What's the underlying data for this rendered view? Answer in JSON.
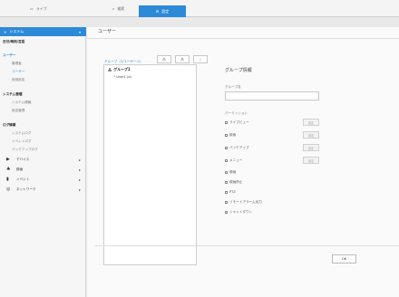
{
  "topbar": {
    "tabs": [
      {
        "label": "ライブ",
        "icon": "monitor-icon"
      },
      {
        "label": "検索",
        "icon": "search-icon"
      },
      {
        "label": "設定",
        "icon": "gear-icon"
      }
    ]
  },
  "sidebar": {
    "header": "システム",
    "items": [
      {
        "label": "日付/時刻/言語"
      },
      {
        "label": "ユーザー"
      },
      {
        "label": "管理者"
      },
      {
        "label": "ユーザー"
      },
      {
        "label": "使用設定"
      },
      {
        "label": "システム管理"
      },
      {
        "label": "システム情報"
      },
      {
        "label": "設定管理"
      },
      {
        "label": "ログ情報"
      },
      {
        "label": "システムログ"
      },
      {
        "label": "イベントログ"
      },
      {
        "label": "バックアップログ"
      }
    ],
    "categories": [
      {
        "label": "デバイス"
      },
      {
        "label": "録画"
      },
      {
        "label": "イベント"
      },
      {
        "label": "ネットワーク"
      }
    ]
  },
  "page": {
    "title": "ユーザー",
    "panel_label": "グループ（1/ユーザー:1）",
    "tree": {
      "root": "グループ1",
      "child": "User1 (a)"
    },
    "group_info": "グループ情報",
    "group_name_label": "グループ名",
    "group_name_value": "",
    "permission_label": "パーミッション",
    "permissions": [
      {
        "label": "ライブビュー",
        "setting": "設定"
      },
      {
        "label": "検索",
        "setting": "設定"
      },
      {
        "label": "バックアップ",
        "setting": "設定"
      },
      {
        "label": "メニュー",
        "setting": "設定"
      },
      {
        "label": "録画"
      },
      {
        "label": "録画停止"
      },
      {
        "label": "PTZ"
      },
      {
        "label": "リモートアラーム出力"
      },
      {
        "label": "シャットダウン"
      }
    ],
    "ok_label": "OK"
  }
}
